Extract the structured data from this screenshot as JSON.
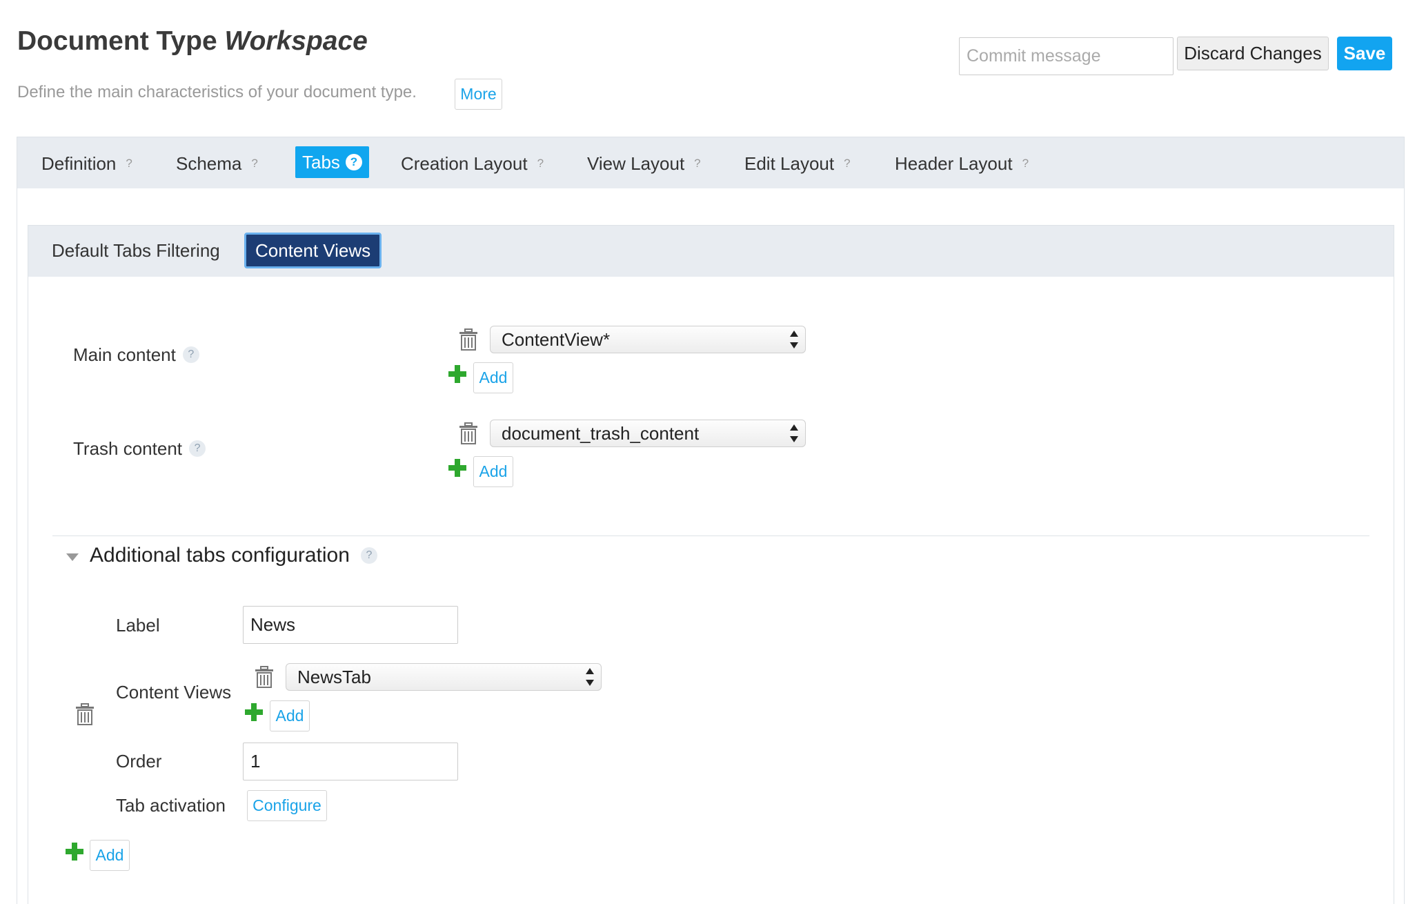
{
  "header": {
    "title_prefix": "Document Type ",
    "title_name": "Workspace",
    "subtitle": "Define the main characteristics of your document type.",
    "more_label": "More",
    "commit_placeholder": "Commit message",
    "discard_label": "Discard Changes",
    "save_label": "Save"
  },
  "tabs": [
    {
      "label": "Definition",
      "help": "?"
    },
    {
      "label": "Schema",
      "help": "?"
    },
    {
      "label": "Tabs",
      "help": "?",
      "active": true
    },
    {
      "label": "Creation Layout",
      "help": "?"
    },
    {
      "label": "View Layout",
      "help": "?"
    },
    {
      "label": "Edit Layout",
      "help": "?"
    },
    {
      "label": "Header Layout",
      "help": "?"
    }
  ],
  "subtabs": [
    {
      "label": "Default Tabs Filtering"
    },
    {
      "label": "Content Views",
      "active": true
    }
  ],
  "main_content": {
    "label": "Main content",
    "help": "?",
    "value": "ContentView*",
    "add_label": "Add"
  },
  "trash_content": {
    "label": "Trash content",
    "help": "?",
    "value": "document_trash_content",
    "add_label": "Add"
  },
  "additional": {
    "title": "Additional tabs configuration",
    "help": "?",
    "label_field": {
      "label": "Label",
      "value": "News"
    },
    "content_views": {
      "label": "Content Views",
      "value": "NewsTab",
      "add_label": "Add"
    },
    "order": {
      "label": "Order",
      "value": "1"
    },
    "tab_activation": {
      "label": "Tab activation",
      "button": "Configure"
    },
    "add_label": "Add"
  },
  "colors": {
    "accent": "#10a6ef",
    "active_subtab": "#1c3d74",
    "tabbar_bg": "#e8ecf1",
    "plus_green": "#2ea82e",
    "link": "#1aa3e8"
  },
  "icons": [
    "trash-icon",
    "plus-icon",
    "help-icon",
    "caret-down-icon",
    "select-arrows-icon"
  ]
}
